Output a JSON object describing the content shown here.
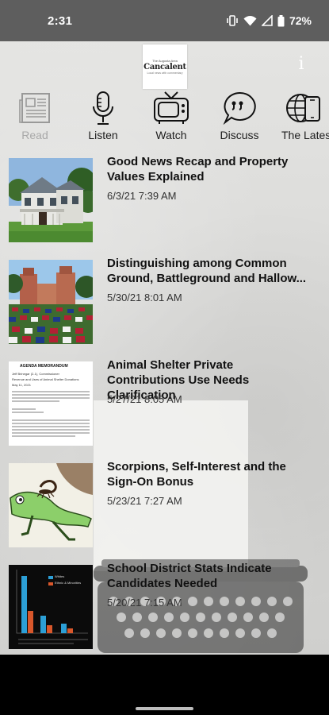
{
  "status_bar": {
    "time": "2:31",
    "battery": "72%"
  },
  "header": {
    "logo": {
      "top": "The Augusta Area",
      "name": "Cancalent",
      "sub": "Local news with commentary"
    },
    "info_label": "i"
  },
  "nav": {
    "items": [
      {
        "label": "Read",
        "icon": "newspaper-icon",
        "active": false
      },
      {
        "label": "Listen",
        "icon": "microphone-icon",
        "active": true
      },
      {
        "label": "Watch",
        "icon": "tv-icon",
        "active": true
      },
      {
        "label": "Discuss",
        "icon": "chat-bubble-icon",
        "active": true
      },
      {
        "label": "The Latest",
        "icon": "globe-phone-icon",
        "active": true
      }
    ]
  },
  "articles": [
    {
      "title": "Good News Recap and Property Values Explained",
      "date": "6/3/21 7:39 AM",
      "thumb": "house"
    },
    {
      "title": "Distinguishing among Common Ground, Battleground and Hallow...",
      "date": "5/30/21 8:01 AM",
      "thumb": "flags"
    },
    {
      "title": "Animal Shelter Private Contributions Use Needs Clarification",
      "date": "5/27/21 8:05 AM",
      "thumb": "memo"
    },
    {
      "title": "Scorpions, Self-Interest and the Sign-On Bonus",
      "date": "5/23/21 7:27 AM",
      "thumb": "frog"
    },
    {
      "title": "School District Stats Indicate Candidates Needed",
      "date": "5/20/21 7:15 AM",
      "thumb": "chart"
    }
  ],
  "memo_thumb": {
    "heading": "AGENDA MEMORANDUM",
    "to": "Jeff Brinegar (2-1), Commissioner",
    "re": "Revenue and Uses of Animal Shelter Donations",
    "date": "May 11, 2021"
  },
  "chart_thumb": {
    "legend": [
      "Whites",
      "Ethnic & Minorities"
    ]
  },
  "colors": {
    "status_bar_bg": "#5e5e5e",
    "chart_blue": "#2c9fd6",
    "chart_orange": "#d9572b"
  }
}
